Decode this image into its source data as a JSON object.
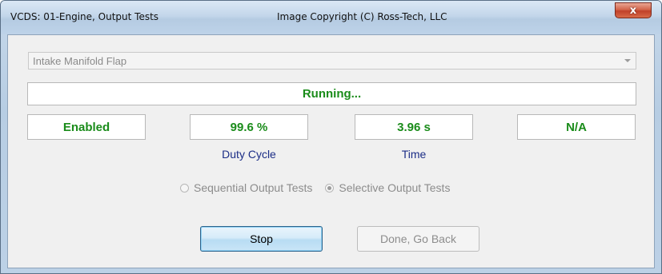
{
  "window": {
    "title": "VCDS: 01-Engine,  Output Tests",
    "copyright": "Image Copyright (C) Ross-Tech, LLC",
    "close_glyph": "x"
  },
  "test_selector": {
    "selected": "Intake Manifold Flap"
  },
  "status": {
    "text": "Running..."
  },
  "fields": [
    {
      "value": "Enabled",
      "caption": ""
    },
    {
      "value": "99.6 %",
      "caption": "Duty Cycle"
    },
    {
      "value": "3.96 s",
      "caption": "Time"
    },
    {
      "value": "N/A",
      "caption": ""
    }
  ],
  "mode": {
    "options": [
      {
        "label": "Sequential Output Tests",
        "checked": false
      },
      {
        "label": "Selective Output Tests",
        "checked": true
      }
    ],
    "enabled": false
  },
  "buttons": {
    "stop": "Stop",
    "done": "Done, Go Back"
  },
  "colors": {
    "value_text": "#1a8c1a",
    "caption_text": "#1b2d86"
  }
}
